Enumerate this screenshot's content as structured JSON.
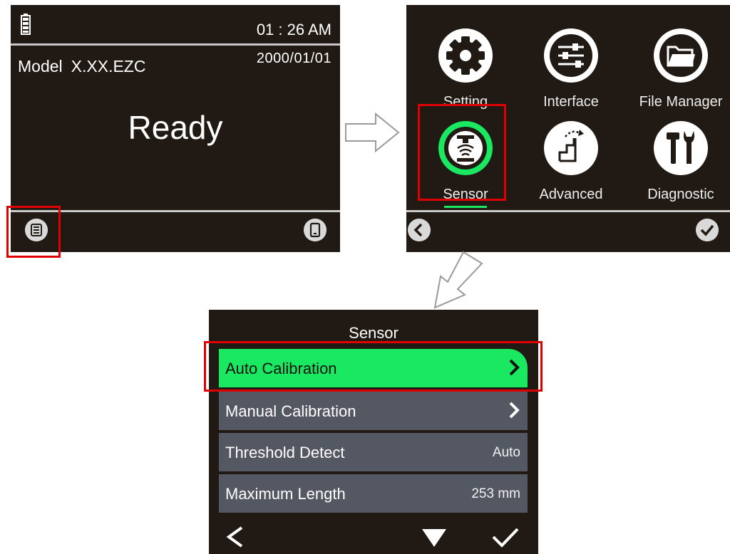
{
  "screen_home": {
    "time": "01 : 26 AM",
    "date": "2000/01/01",
    "model_label": "Model",
    "model_value": "X.XX.EZC",
    "status": "Ready",
    "icons": [
      "battery-icon",
      "menu-icon",
      "device-icon"
    ]
  },
  "screen_menu": {
    "items": [
      {
        "label": "Setting",
        "icon": "gear-icon"
      },
      {
        "label": "Interface",
        "icon": "sliders-icon"
      },
      {
        "label": "File Manager",
        "icon": "folder-icon"
      },
      {
        "label": "Sensor",
        "icon": "sensor-icon",
        "selected": true
      },
      {
        "label": "Advanced",
        "icon": "stairs-icon"
      },
      {
        "label": "Diagnostic",
        "icon": "tools-icon"
      }
    ],
    "nav": [
      "back-icon",
      "confirm-icon"
    ]
  },
  "screen_sensor": {
    "title": "Sensor",
    "rows": [
      {
        "label": "Auto Calibration",
        "value": "",
        "has_submenu": true,
        "selected": true
      },
      {
        "label": "Manual Calibration",
        "value": "",
        "has_submenu": true
      },
      {
        "label": "Threshold Detect",
        "value": "Auto"
      },
      {
        "label": "Maximum Length",
        "value": "253 mm"
      }
    ],
    "nav": [
      "back-icon",
      "down-icon",
      "check-icon"
    ]
  },
  "colors": {
    "screen_bg": "#211a14",
    "highlight_green": "#19e860",
    "row_bg": "#545862",
    "callout_red": "#e00000"
  }
}
